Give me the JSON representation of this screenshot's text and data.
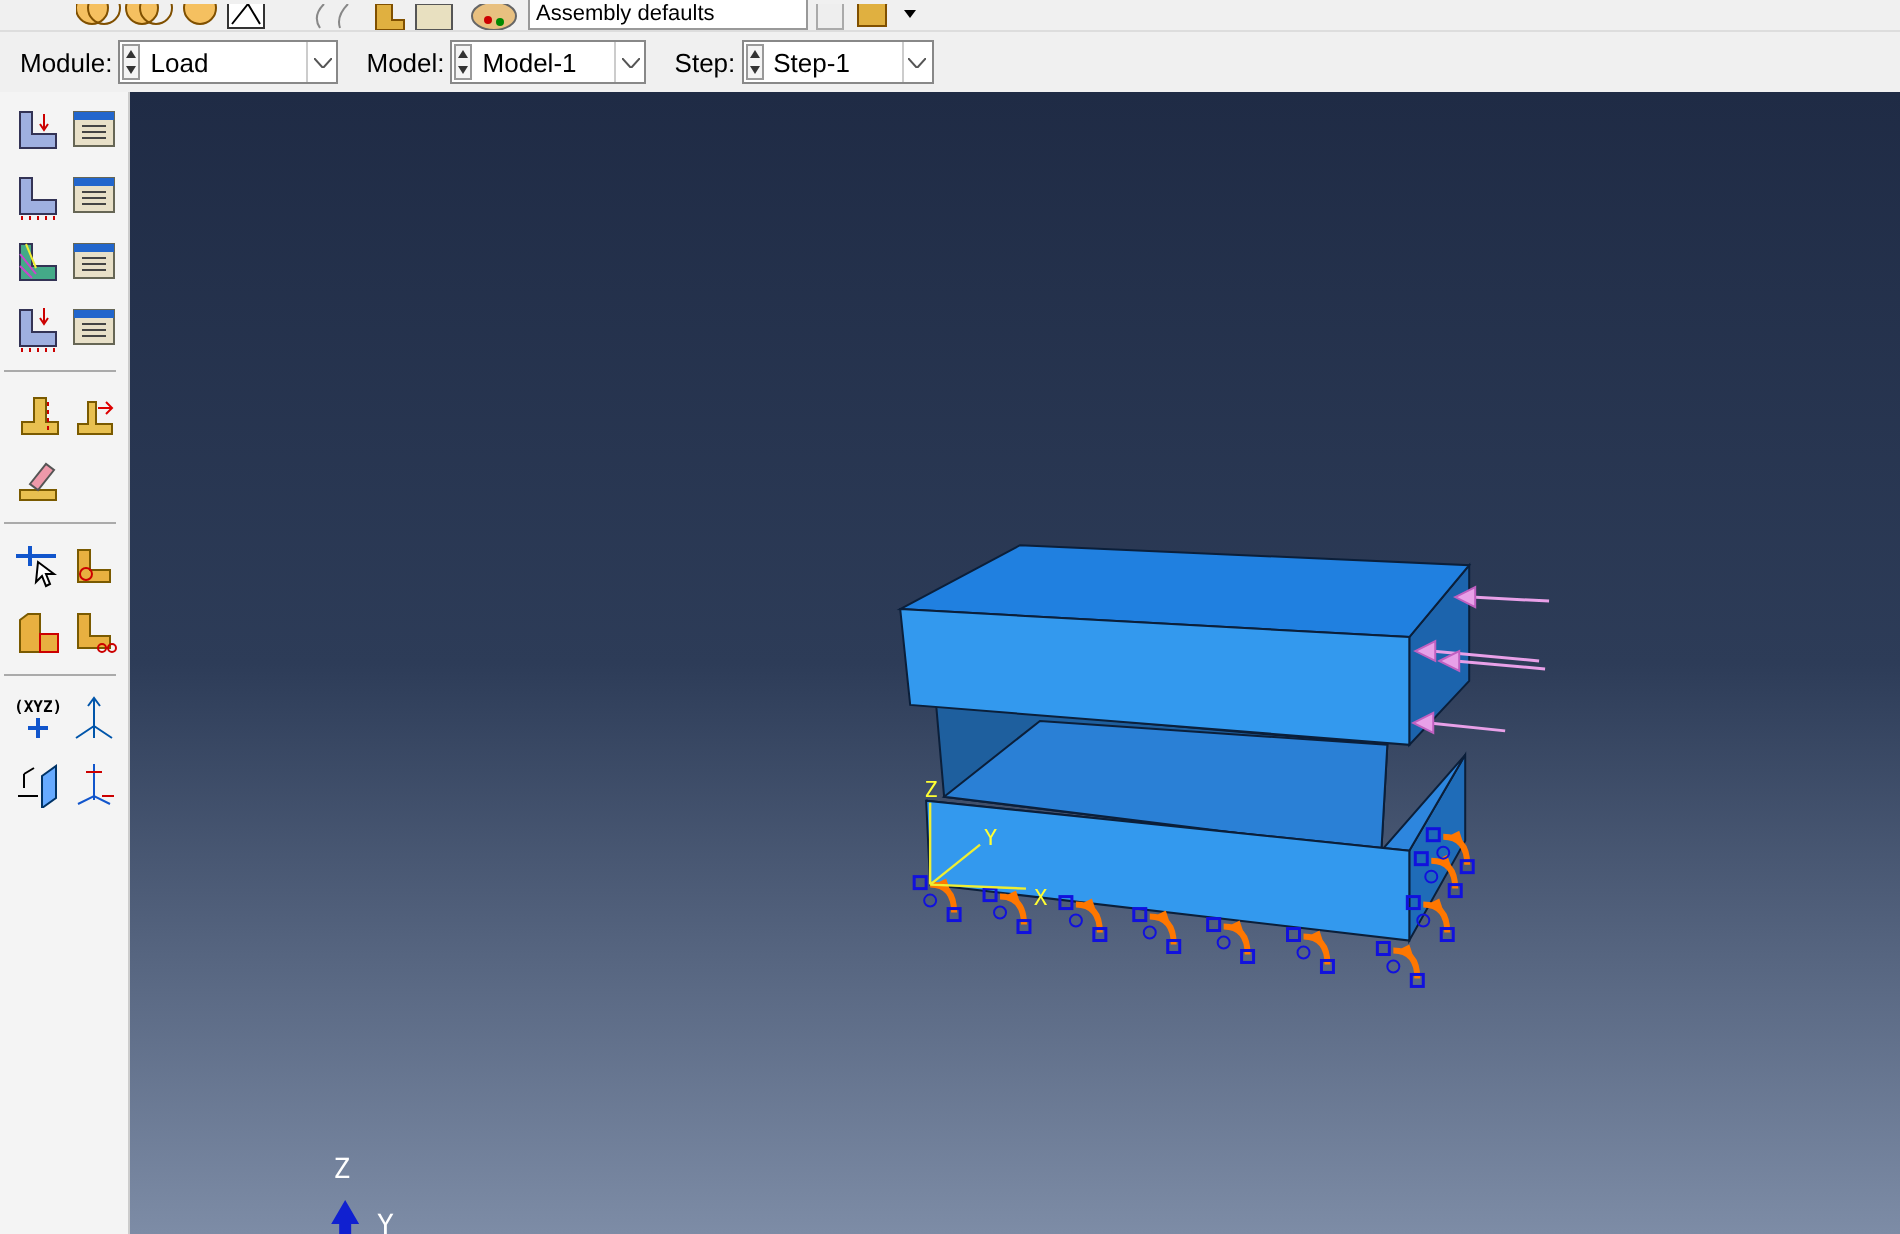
{
  "toolbar": {
    "render_style_combo": "Assembly defaults"
  },
  "context_bar": {
    "fields": [
      {
        "label": "Module:",
        "value": "Load"
      },
      {
        "label": "Model:",
        "value": "Model-1"
      },
      {
        "label": "Step:",
        "value": "Step-1"
      }
    ]
  },
  "toolbox": {
    "datum_point_label": "(XYZ)"
  },
  "viewport": {
    "model_csys": {
      "z": "Z",
      "y": "Y",
      "x": "X"
    },
    "view_triad": {
      "z": "Z",
      "y": "Y"
    }
  }
}
